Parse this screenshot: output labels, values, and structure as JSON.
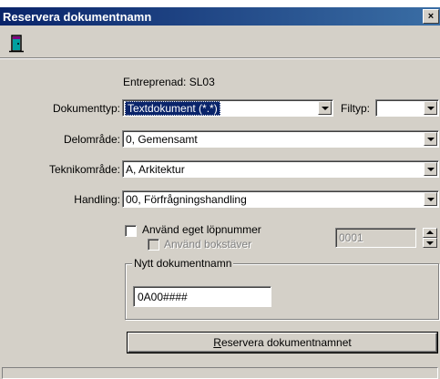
{
  "window": {
    "title": "Reservera dokumentnamn",
    "close_label": "×"
  },
  "toolbar": {
    "icon": "exit-door-icon"
  },
  "form": {
    "entreprenad": "Entreprenad: SL03",
    "dokumenttyp_label": "Dokumenttyp:",
    "dokumenttyp_value": "Textdokument (*.*)",
    "filtyp_label": "Filtyp:",
    "filtyp_value": "",
    "delomrade_label": "Delområde:",
    "delomrade_value": "0,  Gemensamt",
    "teknikomrade_label": "Teknikområde:",
    "teknikomrade_value": "A,  Arkitektur",
    "handling_label": "Handling:",
    "handling_value": "00,  Förfrågningshandling",
    "own_number_label": "Använd eget löpnummer",
    "own_number_checked": false,
    "use_letters_label": "Använd bokstäver",
    "use_letters_checked": false,
    "number_value": "0001"
  },
  "new_name": {
    "legend": "Nytt dokumentnamn",
    "value": "0A00####"
  },
  "reserve_button": {
    "accel": "R",
    "rest": "eservera  dokumentnamnet"
  },
  "colors": {
    "title_bar": "#0a246a",
    "face": "#d4d0c8",
    "selection": "#0a246a"
  }
}
